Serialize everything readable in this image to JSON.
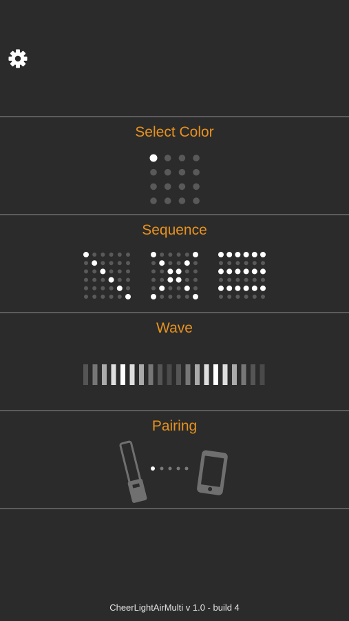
{
  "header": {
    "settings_icon": "gear-icon"
  },
  "menu": {
    "items": [
      {
        "id": "select-color",
        "label": "Select Color",
        "icon": "color-grid-icon"
      },
      {
        "id": "sequence",
        "label": "Sequence",
        "icon": "sequence-patterns-icon"
      },
      {
        "id": "wave",
        "label": "Wave",
        "icon": "wave-bars-icon"
      },
      {
        "id": "pairing",
        "label": "Pairing",
        "icon": "pairing-lightstick-phone-icon"
      }
    ]
  },
  "footer": {
    "version_text": "CheerLightAirMulti v 1.0 - build 4"
  }
}
